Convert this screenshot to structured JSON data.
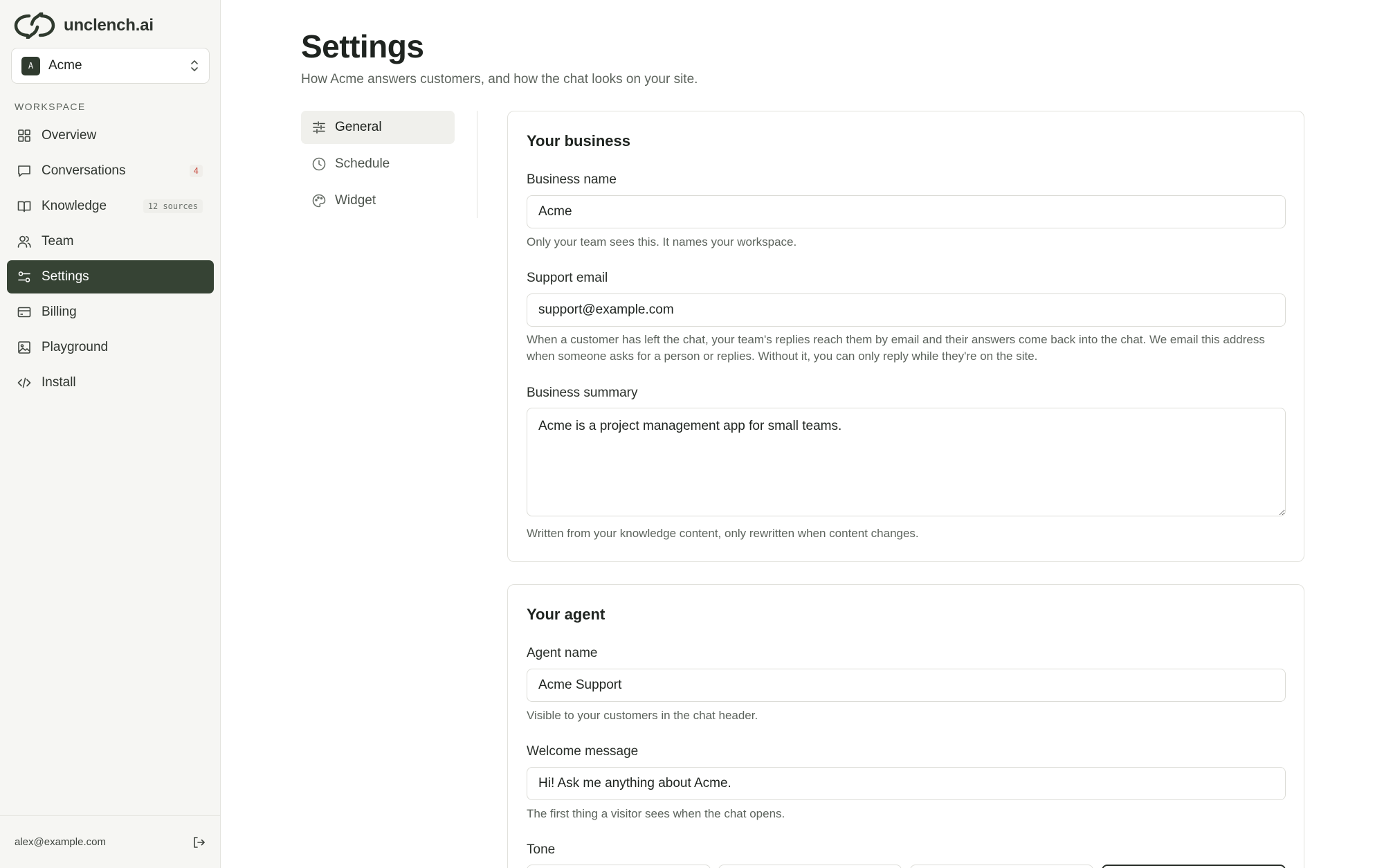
{
  "app": {
    "name": "unclench.ai"
  },
  "workspace": {
    "badge": "A",
    "name": "Acme"
  },
  "sidebar": {
    "heading": "WORKSPACE",
    "items": [
      {
        "label": "Overview",
        "icon": "grid-icon"
      },
      {
        "label": "Conversations",
        "icon": "message-icon",
        "count": "4"
      },
      {
        "label": "Knowledge",
        "icon": "book-icon",
        "meta": "12 sources"
      },
      {
        "label": "Team",
        "icon": "users-icon"
      },
      {
        "label": "Settings",
        "icon": "sliders-icon",
        "active": true
      },
      {
        "label": "Billing",
        "icon": "credit-card-icon"
      },
      {
        "label": "Playground",
        "icon": "image-icon"
      },
      {
        "label": "Install",
        "icon": "code-icon"
      }
    ],
    "user_email": "alex@example.com"
  },
  "page": {
    "title": "Settings",
    "subtitle": "How Acme answers customers, and how the chat looks on your site."
  },
  "subnav": [
    {
      "label": "General",
      "icon": "sliders-icon",
      "active": true
    },
    {
      "label": "Schedule",
      "icon": "clock-icon"
    },
    {
      "label": "Widget",
      "icon": "palette-icon"
    }
  ],
  "business": {
    "title": "Your business",
    "name_label": "Business name",
    "name_value": "Acme",
    "name_help": "Only your team sees this. It names your workspace.",
    "email_label": "Support email",
    "email_value": "support@example.com",
    "email_help": "When a customer has left the chat, your team's replies reach them by email and their answers come back into the chat. We email this address when someone asks for a person or replies. Without it, you can only reply while they're on the site.",
    "summary_label": "Business summary",
    "summary_value": "Acme is a project management app for small teams.",
    "summary_help": "Written from your knowledge content, only rewritten when content changes."
  },
  "agent": {
    "title": "Your agent",
    "name_label": "Agent name",
    "name_value": "Acme Support",
    "name_help": "Visible to your customers in the chat header.",
    "welcome_label": "Welcome message",
    "welcome_value": "Hi! Ask me anything about Acme.",
    "welcome_help": "The first thing a visitor sees when the chat opens.",
    "tone_label": "Tone"
  },
  "colors": {
    "accent": "#364334",
    "danger": "#c94a3e"
  }
}
